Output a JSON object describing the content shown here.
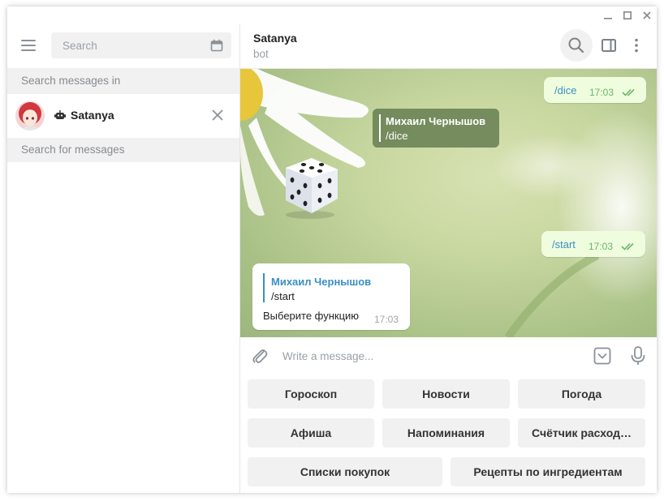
{
  "window": {
    "controls": [
      "minimize",
      "maximize",
      "close"
    ]
  },
  "sidebar": {
    "search_placeholder": "Search",
    "search_in_label": "Search messages in",
    "chat": {
      "name": "Satanya"
    },
    "search_for_messages": "Search for messages"
  },
  "header": {
    "title": "Satanya",
    "status": "bot"
  },
  "messages": {
    "out1": {
      "text": "/dice",
      "time": "17:03"
    },
    "reply_dark": {
      "author": "Михаил Чернышов",
      "text": "/dice"
    },
    "out2": {
      "text": "/start",
      "time": "17:03"
    },
    "in1": {
      "reply_author": "Михаил Чернышов",
      "reply_text": "/start",
      "text": "Выберите функцию",
      "time": "17:03"
    }
  },
  "composer": {
    "placeholder": "Write a message..."
  },
  "keyboard": {
    "row1": [
      "Гороскоп",
      "Новости",
      "Погода"
    ],
    "row2": [
      "Афиша",
      "Напоминания",
      "Счётчик расход…"
    ],
    "row3": [
      "Списки покупок",
      "Рецепты по ингредиентам"
    ]
  },
  "colors": {
    "accent": "#3a8fc4",
    "outgoing_bubble": "#effdde",
    "read_ticks": "#6cb46c",
    "button_bg": "#f1f1f1"
  }
}
